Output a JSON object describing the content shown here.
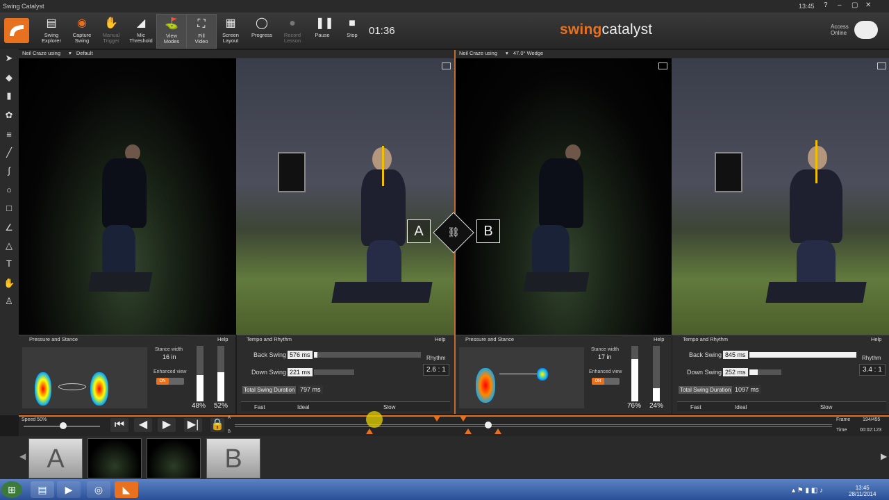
{
  "window": {
    "title": "Swing Catalyst",
    "clock": "13:45",
    "controls": [
      "?",
      "–",
      "▢",
      "✕"
    ]
  },
  "toolbar": {
    "buttons": [
      {
        "label_1": "Swing",
        "label_2": "Explorer",
        "icon": "folder-icon"
      },
      {
        "label_1": "Capture",
        "label_2": "Swing",
        "icon": "record-icon"
      },
      {
        "label_1": "Manual",
        "label_2": "Trigger",
        "icon": "hand-icon"
      },
      {
        "label_1": "Mic",
        "label_2": "Threshold",
        "icon": "mic-threshold-icon"
      },
      {
        "label_1": "View",
        "label_2": "Modes",
        "icon": "golfer-icon"
      },
      {
        "label_1": "Fill",
        "label_2": "Video",
        "icon": "fullscreen-icon"
      },
      {
        "label_1": "Screen",
        "label_2": "Layout",
        "icon": "grid-icon"
      },
      {
        "label_1": "Progress",
        "label_2": "",
        "icon": "progress-icon"
      },
      {
        "label_1": "Record",
        "label_2": "Lesson",
        "icon": "speech-icon"
      },
      {
        "label_1": "Pause",
        "label_2": "",
        "icon": "pause-icon"
      },
      {
        "label_1": "Stop",
        "label_2": "",
        "icon": "stop-icon"
      }
    ],
    "timer": "01:36",
    "brand_accent": "swing",
    "brand_rest": "catalyst",
    "access_1": "Access",
    "access_2": "Online"
  },
  "colors": {
    "accent": "#e8711f",
    "background": "#1b1b1b",
    "panel": "#2c2c2c"
  },
  "left_panel": {
    "user": "Neil Craze using",
    "club": "Default",
    "pressure_title": "Pressure and Stance",
    "tempo_title": "Tempo and Rhythm",
    "help": "Help",
    "stance_width_label": "Stance width",
    "stance_width": "16 in",
    "enhanced_label": "Enhanced view",
    "toggle": "ON",
    "left_pct": "48%",
    "right_pct": "52%",
    "left_fill": 0.48,
    "right_fill": 0.52,
    "back_swing_label": "Back Swing",
    "back_swing": "576 ms",
    "back_fill": 0.03,
    "down_swing_label": "Down Swing",
    "down_swing": "221 ms",
    "down_fill": 0.0,
    "rhythm_label": "Rhythm",
    "rhythm": "2.6 : 1",
    "total_label": "Total Swing Duration",
    "total": "797 ms",
    "scale": [
      "Fast",
      "Ideal",
      "Slow"
    ],
    "ab_label": "A"
  },
  "right_panel": {
    "user": "Neil Craze using",
    "club": "47.0° Wedge",
    "pressure_title": "Pressure and Stance",
    "tempo_title": "Tempo and Rhythm",
    "help": "Help",
    "stance_width_label": "Stance width",
    "stance_width": "17 in",
    "enhanced_label": "Enhanced view",
    "toggle": "ON",
    "left_pct": "76%",
    "right_pct": "24%",
    "left_fill": 0.76,
    "right_fill": 0.24,
    "back_swing_label": "Back Swing",
    "back_swing": "845 ms",
    "back_fill": 1.0,
    "down_swing_label": "Down Swing",
    "down_swing": "252 ms",
    "down_fill": 0.25,
    "rhythm_label": "Rhythm",
    "rhythm": "3.4 : 1",
    "total_label": "Total Swing Duration",
    "total": "1097 ms",
    "scale": [
      "Fast",
      "Ideal",
      "Slow"
    ],
    "ab_label": "B"
  },
  "transport": {
    "speed": "Speed 50%",
    "frame_label": "Frame",
    "frame": "194/455",
    "time_label": "Time",
    "time": "00:02:123",
    "a_label": "A",
    "b_label": "B"
  },
  "thumbnails": [
    {
      "type": "letter",
      "label": "A"
    },
    {
      "type": "video",
      "label": ""
    },
    {
      "type": "video",
      "label": ""
    },
    {
      "type": "letter",
      "label": "B"
    }
  ],
  "taskbar": {
    "time": "13:45",
    "date": "28/11/2014"
  }
}
